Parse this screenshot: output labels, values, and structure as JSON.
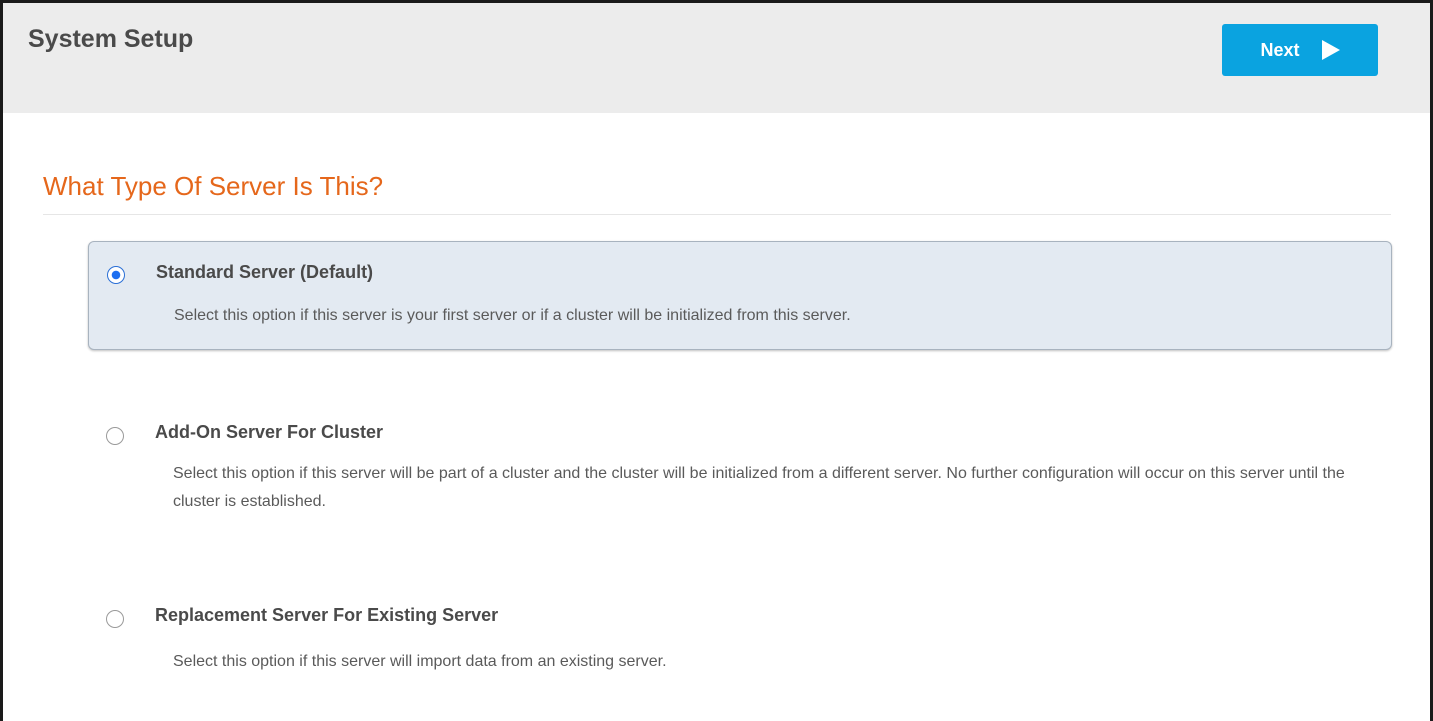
{
  "header": {
    "title": "System Setup",
    "next_label": "Next"
  },
  "main": {
    "section_title": "What Type Of Server Is This?",
    "options": [
      {
        "title": "Standard Server (Default)",
        "description": "Select this option if this server is your first server or if a cluster will be initialized from this server.",
        "selected": true
      },
      {
        "title": "Add-On Server For Cluster",
        "description": "Select this option if this server will be part of a cluster and the cluster will be initialized from a different server. No further configuration will occur on this server until the cluster is established.",
        "selected": false
      },
      {
        "title": "Replacement Server For Existing Server",
        "description": "Select this option if this server will import data from an existing server.",
        "selected": false
      }
    ]
  },
  "colors": {
    "accent": "#0aa3e0",
    "section_title": "#e5671b",
    "selected_bg": "#e3eaf2",
    "radio_checked": "#1e6ff0"
  }
}
